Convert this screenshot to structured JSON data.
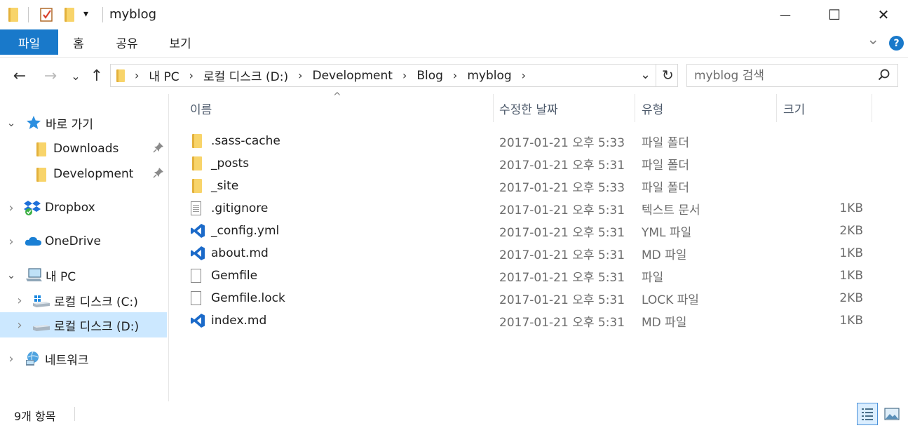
{
  "window": {
    "title": "myblog",
    "minimize_glyph": "—",
    "maximize_glyph": "☐",
    "close_glyph": "✕",
    "quick_access_dropdown": "▾"
  },
  "ribbon": {
    "tabs": [
      {
        "label": "파일",
        "active": true
      },
      {
        "label": "홈"
      },
      {
        "label": "공유"
      },
      {
        "label": "보기"
      }
    ],
    "expand_glyph": "⌄",
    "help_glyph": "?",
    "accent_color": "#1979ca"
  },
  "navigation": {
    "back_glyph": "←",
    "forward_glyph": "→",
    "recent_glyph": "⌄",
    "up_glyph": "↑",
    "breadcrumb": [
      "내 PC",
      "로컬 디스크 (D:)",
      "Development",
      "Blog",
      "myblog"
    ],
    "separator": "›",
    "dropdown_glyph": "⌄",
    "refresh_glyph": "↻"
  },
  "search": {
    "placeholder": "myblog 검색",
    "icon": "search-icon"
  },
  "sidebar": {
    "items": [
      {
        "label": "바로 가기",
        "expander": "⌄",
        "icon": "star-icon"
      },
      {
        "label": "Downloads",
        "icon": "folder-icon",
        "pinned": true
      },
      {
        "label": "Development",
        "icon": "folder-icon",
        "pinned": true
      },
      {
        "label": "Dropbox",
        "expander": "›",
        "icon": "dropbox-icon"
      },
      {
        "label": "OneDrive",
        "expander": "›",
        "icon": "cloud-icon"
      },
      {
        "label": "내 PC",
        "expander": "⌄",
        "icon": "computer-icon"
      },
      {
        "label": "로컬 디스크 (C:)",
        "expander": "›",
        "icon": "drive-icon"
      },
      {
        "label": "로컬 디스크 (D:)",
        "expander": "›",
        "icon": "drive-icon",
        "selected": true
      },
      {
        "label": "네트워크",
        "expander": "›",
        "icon": "network-icon"
      }
    ],
    "pin_glyph": "📌"
  },
  "columns": {
    "name": "이름",
    "date": "수정한 날짜",
    "type": "유형",
    "size": "크기",
    "sort_glyph": "^"
  },
  "files": [
    {
      "name": ".sass-cache",
      "date": "2017-01-21 오후 5:33",
      "type": "파일 폴더",
      "size": "",
      "icon": "folder-icon"
    },
    {
      "name": "_posts",
      "date": "2017-01-21 오후 5:31",
      "type": "파일 폴더",
      "size": "",
      "icon": "folder-icon"
    },
    {
      "name": "_site",
      "date": "2017-01-21 오후 5:33",
      "type": "파일 폴더",
      "size": "",
      "icon": "folder-icon"
    },
    {
      "name": ".gitignore",
      "date": "2017-01-21 오후 5:31",
      "type": "텍스트 문서",
      "size": "1KB",
      "icon": "text-file-icon"
    },
    {
      "name": "_config.yml",
      "date": "2017-01-21 오후 5:31",
      "type": "YML 파일",
      "size": "2KB",
      "icon": "vscode-icon"
    },
    {
      "name": "about.md",
      "date": "2017-01-21 오후 5:31",
      "type": "MD 파일",
      "size": "1KB",
      "icon": "vscode-icon"
    },
    {
      "name": "Gemfile",
      "date": "2017-01-21 오후 5:31",
      "type": "파일",
      "size": "1KB",
      "icon": "blank-file-icon"
    },
    {
      "name": "Gemfile.lock",
      "date": "2017-01-21 오후 5:31",
      "type": "LOCK 파일",
      "size": "2KB",
      "icon": "blank-file-icon"
    },
    {
      "name": "index.md",
      "date": "2017-01-21 오후 5:31",
      "type": "MD 파일",
      "size": "1KB",
      "icon": "vscode-icon"
    }
  ],
  "status": {
    "item_count": "9개 항목"
  }
}
